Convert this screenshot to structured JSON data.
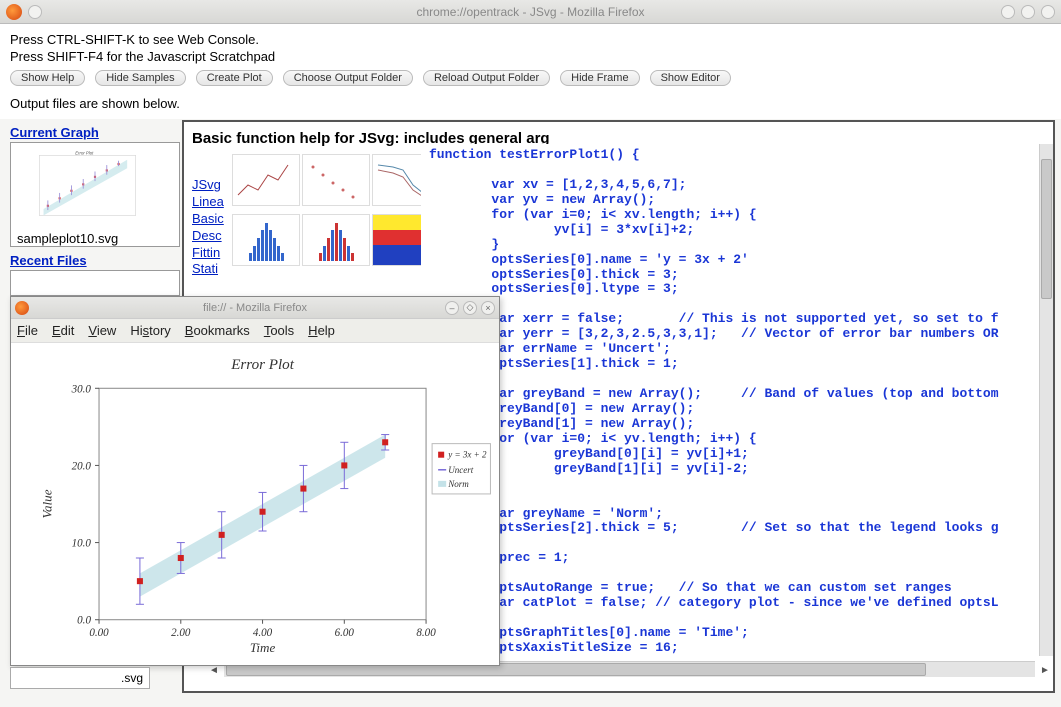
{
  "window": {
    "title": "chrome://opentrack - JSvg - Mozilla Firefox"
  },
  "instructions": {
    "line1": "Press CTRL-SHIFT-K to see Web Console.",
    "line2": "Press SHIFT-F4 for the Javascript Scratchpad"
  },
  "toolbar": {
    "show_help": "Show Help",
    "hide_samples": "Hide Samples",
    "create_plot": "Create Plot",
    "choose_output": "Choose Output Folder",
    "reload_output": "Reload Output Folder",
    "hide_frame": "Hide Frame",
    "show_editor": "Show Editor"
  },
  "output_msg": "Output files are shown below.",
  "left": {
    "current_graph": "Current Graph",
    "sample_caption": "sampleplot10.svg",
    "recent_files": "Recent Files"
  },
  "frame": {
    "heading": "Basic function help for JSvg: includes general arg",
    "links": {
      "jsvg": "JSvg",
      "linea": "Linea",
      "basic": "Basic",
      "desc": "Desc",
      "fitting": "Fittin",
      "stat": "Stati"
    }
  },
  "code": "function testErrorPlot1() {\n\n        var xv = [1,2,3,4,5,6,7];\n        var yv = new Array();\n        for (var i=0; i< xv.length; i++) {\n                yv[i] = 3*xv[i]+2;\n        }\n        optsSeries[0].name = 'y = 3x + 2'\n        optsSeries[0].thick = 3;\n        optsSeries[0].ltype = 3;\n\n        var xerr = false;       // This is not supported yet, so set to f\n        var yerr = [3,2,3,2.5,3,3,1];   // Vector of error bar numbers OR\n        var errName = 'Uncert';\n        optsSeries[1].thick = 1;\n\n        var greyBand = new Array();     // Band of values (top and bottom\n        greyBand[0] = new Array();\n        greyBand[1] = new Array();\n        for (var i=0; i< yv.length; i++) {\n                greyBand[0][i] = yv[i]+1;\n                greyBand[1][i] = yv[i]-2;\n        }\n\n        var greyName = 'Norm';\n        optsSeries[2].thick = 5;        // Set so that the legend looks g\n\n        vprec = 1;\n\n        optsAutoRange = true;   // So that we can custom set ranges\n        var catPlot = false; // category plot - since we've defined optsL\n\n        optsGraphTitles[0].name = 'Time';\n        optsXaxisTitleSize = 16;",
  "popup": {
    "title": "file:// - Mozilla Firefox",
    "menu": {
      "file": "File",
      "edit": "Edit",
      "view": "View",
      "history": "History",
      "bookmarks": "Bookmarks",
      "tools": "Tools",
      "help": "Help"
    }
  },
  "chart_data": {
    "type": "scatter",
    "title": "Error Plot",
    "xlabel": "Time",
    "ylabel": "Value",
    "xlim": [
      0,
      8
    ],
    "ylim": [
      0,
      30
    ],
    "xticks": [
      0.0,
      2.0,
      4.0,
      6.0,
      8.0
    ],
    "yticks": [
      0.0,
      10.0,
      20.0,
      30.0
    ],
    "series": [
      {
        "name": "y = 3x + 2",
        "x": [
          1,
          2,
          3,
          4,
          5,
          6,
          7
        ],
        "y": [
          5,
          8,
          11,
          14,
          17,
          20,
          23
        ],
        "color": "#d02020",
        "marker": "square"
      },
      {
        "name": "Uncert",
        "yerr": [
          3,
          2,
          3,
          2.5,
          3,
          3,
          1
        ],
        "color": "#7a6bd8"
      },
      {
        "name": "Norm",
        "band_top": [
          6,
          9,
          12,
          15,
          18,
          21,
          24
        ],
        "band_bottom": [
          3,
          6,
          9,
          12,
          15,
          18,
          21
        ],
        "color": "#c4e2e8"
      }
    ]
  },
  "fname_ext": ".svg"
}
